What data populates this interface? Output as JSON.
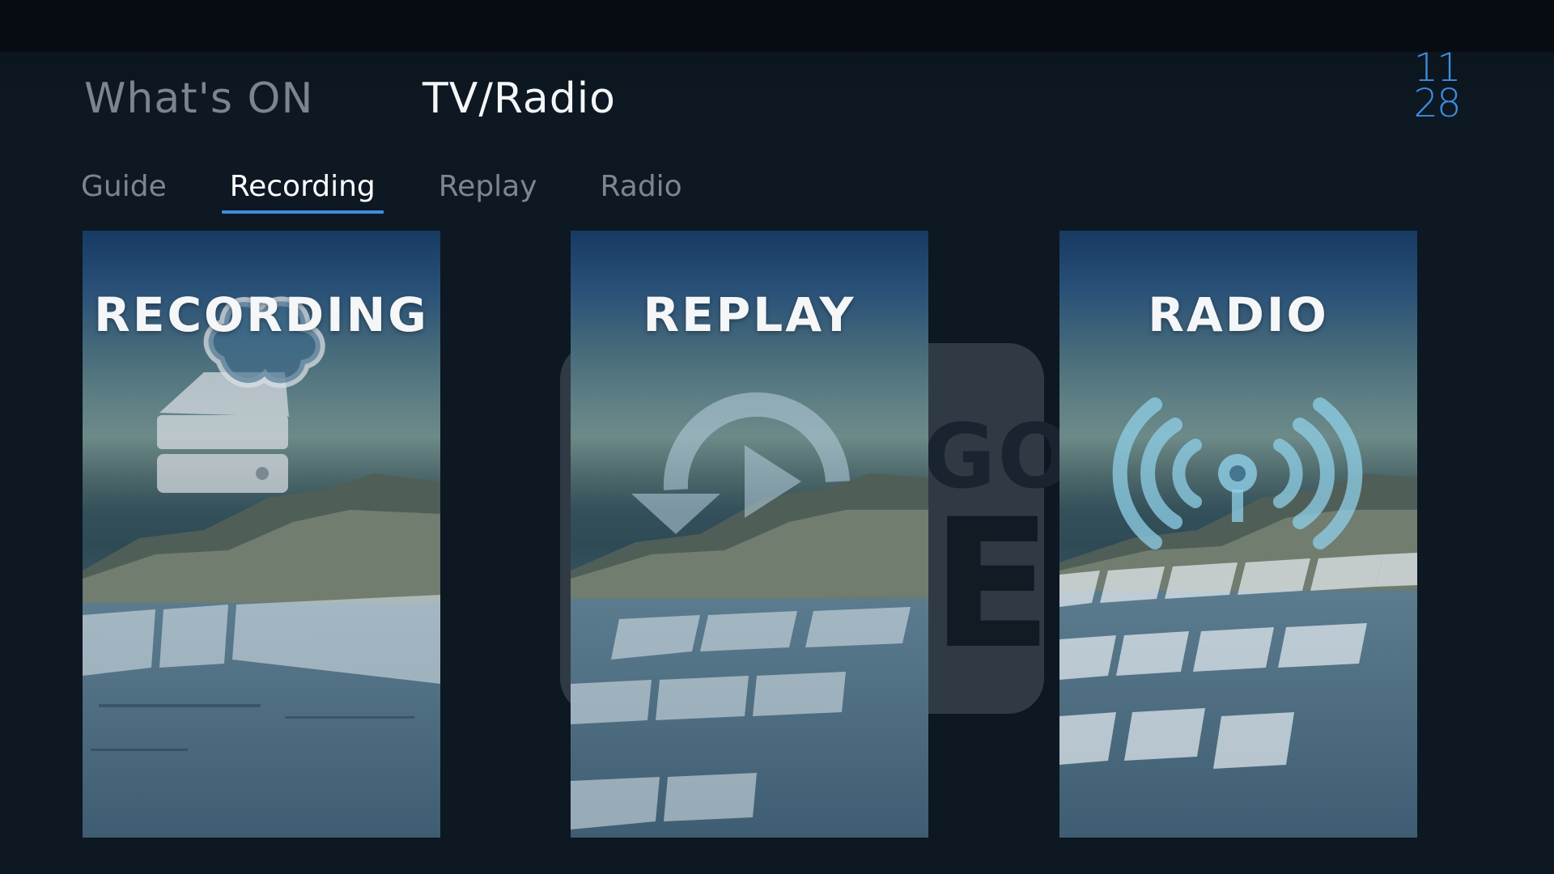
{
  "header": {
    "whats_on": "What's ON",
    "tv_radio": "TV/Radio",
    "clock_hour": "11",
    "clock_minute": "28"
  },
  "tabs": [
    {
      "label": "Guide",
      "active": false
    },
    {
      "label": "Recording",
      "active": true
    },
    {
      "label": "Replay",
      "active": false
    },
    {
      "label": "Radio",
      "active": false
    }
  ],
  "background_tile": {
    "text_top": "GO",
    "text_bottom": "E"
  },
  "cards": [
    {
      "label": "RECORDING",
      "icon": "cloud-recorder-icon"
    },
    {
      "label": "REPLAY",
      "icon": "replay-icon"
    },
    {
      "label": "RADIO",
      "icon": "radio-broadcast-icon"
    }
  ],
  "colors": {
    "accent": "#3d8ee0",
    "background": "#0c141d",
    "inactive_text": "#7d868f",
    "active_text": "#ffffff"
  }
}
